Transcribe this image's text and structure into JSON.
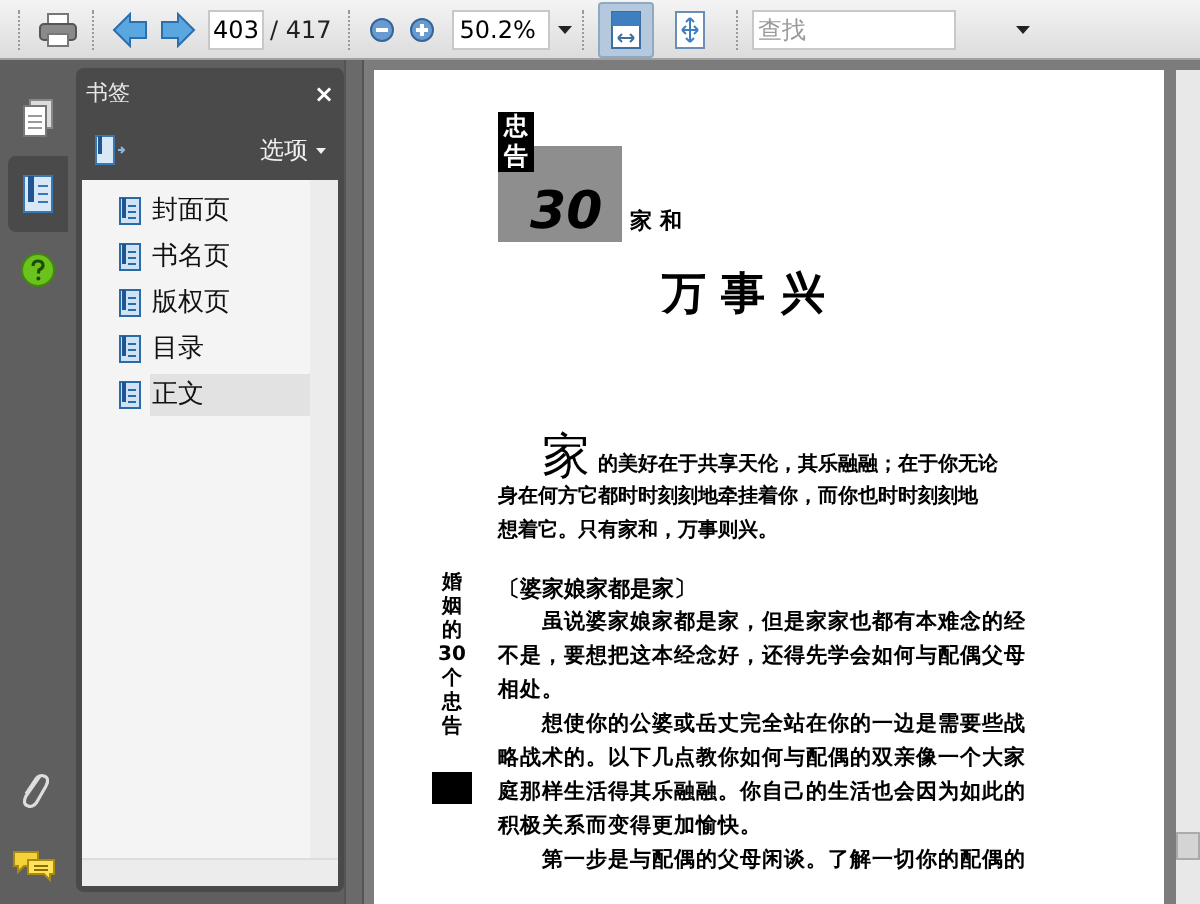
{
  "toolbar": {
    "page_input": "403",
    "page_total": "/ 417",
    "zoom": "50.2%",
    "view_buttons": [
      {
        "kind": "fit-page",
        "selected": true
      },
      {
        "kind": "fit-width",
        "selected": false
      }
    ],
    "search": {
      "placeholder": "查找"
    }
  },
  "left_rail": {
    "tools": [
      {
        "kind": "pages",
        "selected": false
      },
      {
        "kind": "bookmarks",
        "selected": true
      },
      {
        "kind": "help",
        "selected": false
      }
    ],
    "bottom_tools": [
      {
        "kind": "attachments"
      },
      {
        "kind": "comments"
      }
    ]
  },
  "bookmarks_panel": {
    "title": "书签",
    "close": "×",
    "options": "选项",
    "items": [
      {
        "label": "封面页",
        "selected": false
      },
      {
        "label": "书名页",
        "selected": false
      },
      {
        "label": "版权页",
        "selected": false
      },
      {
        "label": "目录",
        "selected": false
      },
      {
        "label": "正文",
        "selected": true
      }
    ]
  },
  "document": {
    "badge": "忠告",
    "number": "30",
    "subtitle": "家 和",
    "title": "万 事 兴",
    "drop_cap": "家",
    "intro_lines": [
      "的美好在于共享天伦，其乐融融；在于你无论",
      "身在何方它都时时刻刻地牵挂着你，而你也时时刻刻地",
      "想着它。只有家和，万事则兴。"
    ],
    "side_label": "婚姻的30个忠告",
    "section_heading": "〔婆家娘家都是家〕",
    "body_lines": [
      {
        "kind": "indent",
        "text": "虽说婆家娘家都是家，但是家家也都有本难念的经"
      },
      {
        "kind": "plain",
        "text": "不是，要想把这本经念好，还得先学会如何与配偶父母"
      },
      {
        "kind": "plain",
        "text": "相处。"
      },
      {
        "kind": "indent",
        "text": "想使你的公婆或岳丈完全站在你的一边是需要些战"
      },
      {
        "kind": "plain",
        "text": "略战术的。以下几点教你如何与配偶的双亲像一个大家"
      },
      {
        "kind": "plain",
        "text": "庭那样生活得其乐融融。你自己的生活也会因为如此的"
      },
      {
        "kind": "plain",
        "text": "积极关系而变得更加愉快。"
      },
      {
        "kind": "indent",
        "text": "第一步是与配偶的父母闲谈。了解一切你的配偶的"
      }
    ]
  }
}
